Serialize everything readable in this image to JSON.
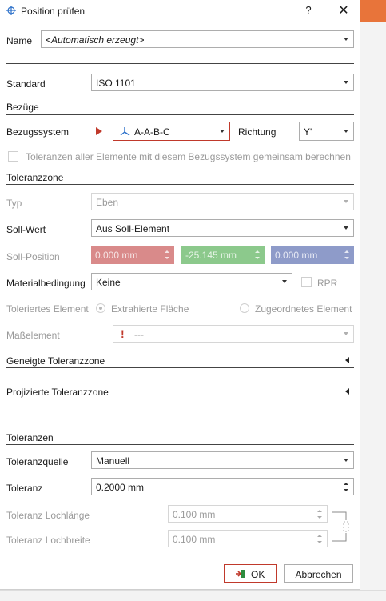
{
  "dialog": {
    "title": "Position prüfen",
    "help": "?",
    "close": "✕"
  },
  "name": {
    "label": "Name",
    "value": "<Automatisch erzeugt>"
  },
  "standard": {
    "label": "Standard",
    "value": "ISO 1101"
  },
  "bezuege": {
    "section": "Bezüge",
    "system_label": "Bezugssystem",
    "system_value": "A-A-B-C",
    "richtung_label": "Richtung",
    "richtung_value": "Y'",
    "checkbox_label": "Toleranzen aller Elemente mit diesem Bezugssystem gemeinsam berechnen"
  },
  "toleranzzone": {
    "section": "Toleranzzone",
    "typ_label": "Typ",
    "typ_value": "Eben",
    "soll_wert_label": "Soll-Wert",
    "soll_wert_value": "Aus Soll-Element",
    "soll_position_label": "Soll-Position",
    "pos_x": "0.000 mm",
    "pos_y": "-25.145 mm",
    "pos_z": "0.000 mm",
    "material_label": "Materialbedingung",
    "material_value": "Keine",
    "rpr_label": "RPR",
    "toleriertes_label": "Toleriertes Element",
    "radio1": "Extrahierte Fläche",
    "radio2": "Zugeordnetes Element",
    "masselement_label": "Maßelement",
    "masselement_value": "---"
  },
  "geneigte": {
    "section": "Geneigte Toleranzzone"
  },
  "projizierte": {
    "section": "Projizierte Toleranzzone"
  },
  "toleranzen": {
    "section": "Toleranzen",
    "quelle_label": "Toleranzquelle",
    "quelle_value": "Manuell",
    "toleranz_label": "Toleranz",
    "toleranz_value": "0.2000 mm",
    "lochlaenge_label": "Toleranz Lochlänge",
    "lochlaenge_value": "0.100 mm",
    "lochbreite_label": "Toleranz Lochbreite",
    "lochbreite_value": "0.100 mm"
  },
  "buttons": {
    "ok": "OK",
    "cancel": "Abbrechen"
  },
  "colors": {
    "x_field": "#d98a8a",
    "y_field": "#8cc98c",
    "z_field": "#8e9bc9",
    "datum_border": "#c0392b",
    "accent_red": "#c0392b"
  }
}
